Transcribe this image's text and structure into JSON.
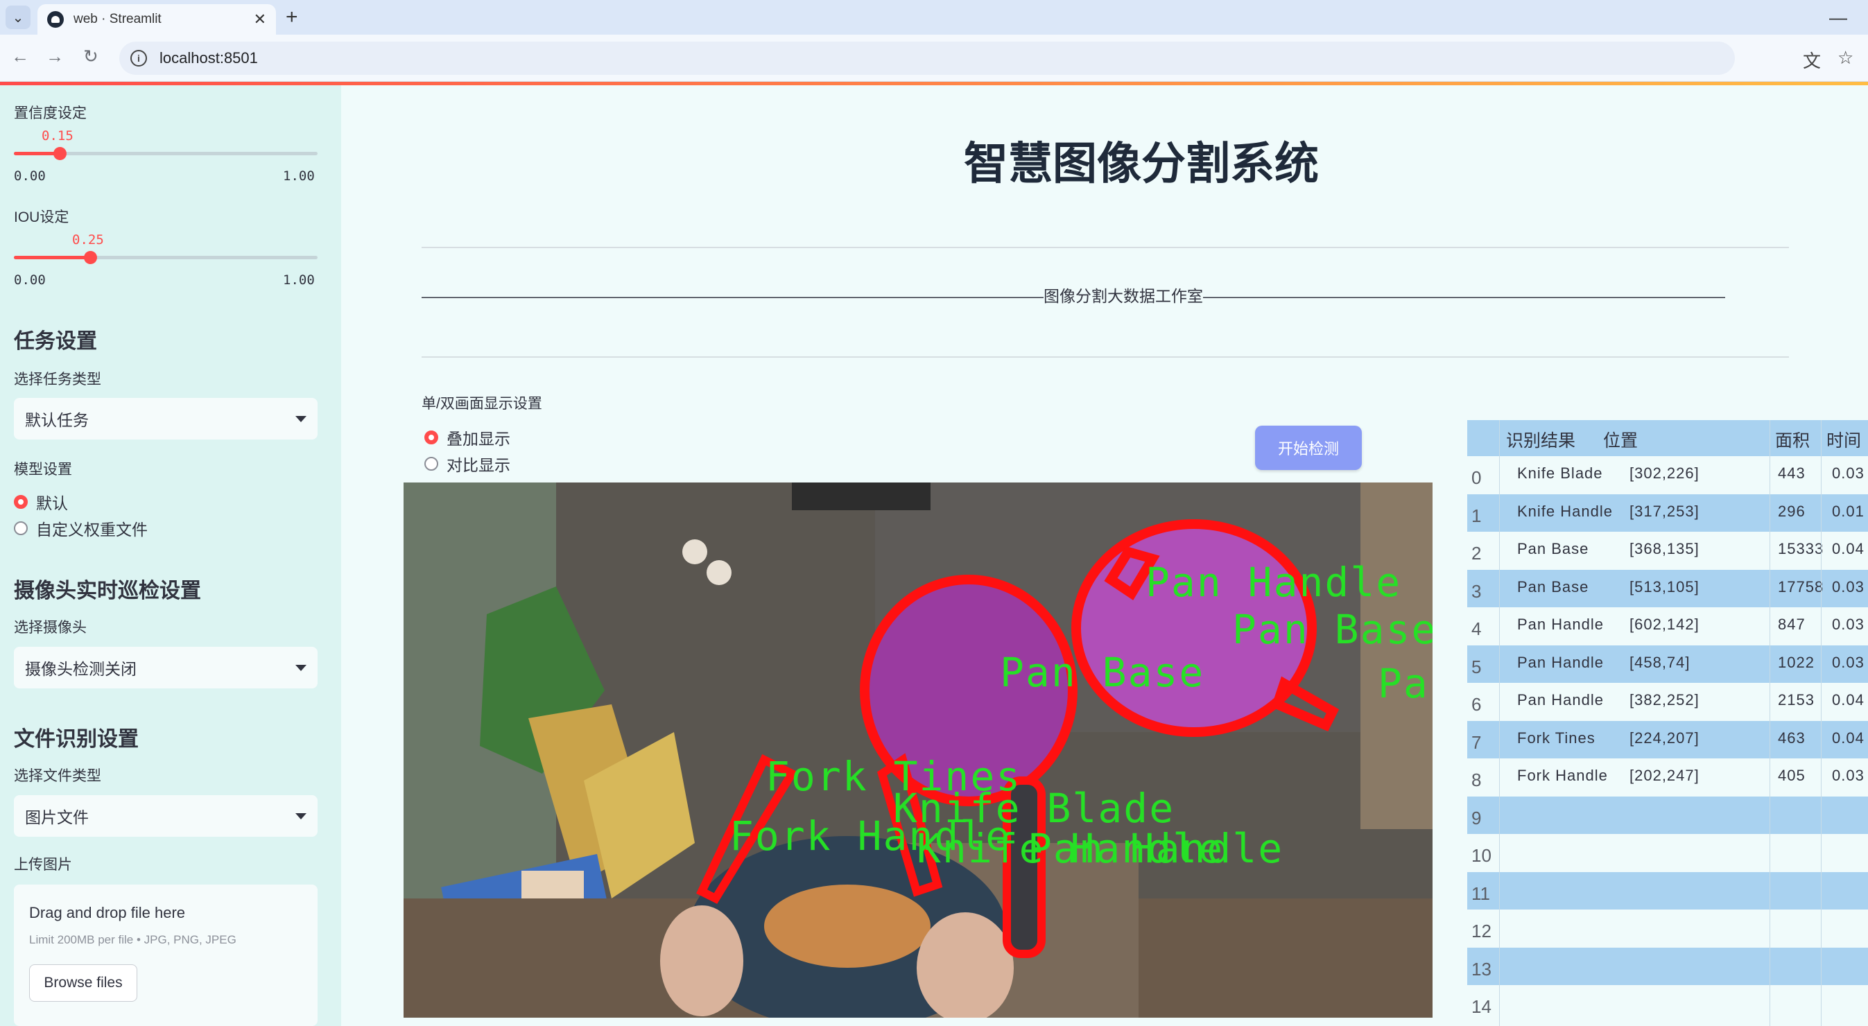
{
  "browser": {
    "tab_title": "web · Streamlit",
    "url": "localhost:8501"
  },
  "sidebar": {
    "confidence": {
      "label": "置信度设定",
      "value": "0.15",
      "min": "0.00",
      "max": "1.00",
      "fraction": 0.15
    },
    "iou": {
      "label": "IOU设定",
      "value": "0.25",
      "min": "0.00",
      "max": "1.00",
      "fraction": 0.25
    },
    "task_heading": "任务设置",
    "task_type_label": "选择任务类型",
    "task_type_value": "默认任务",
    "model_label": "模型设置",
    "model_options": [
      "默认",
      "自定义权重文件"
    ],
    "camera_heading": "摄像头实时巡检设置",
    "camera_label": "选择摄像头",
    "camera_value": "摄像头检测关闭",
    "file_heading": "文件识别设置",
    "file_type_label": "选择文件类型",
    "file_type_value": "图片文件",
    "upload_label": "上传图片",
    "upload_drag": "Drag and drop file here",
    "upload_limit": "Limit 200MB per file • JPG, PNG, JPEG",
    "upload_button": "Browse files"
  },
  "main": {
    "title": "智慧图像分割系统",
    "studio_line": "———————————————————————————————————————图像分割大数据工作室———————————————————————————————————————",
    "view_label": "单/双画面显示设置",
    "view_options": [
      "叠加显示",
      "对比显示"
    ],
    "detect_button": "开始检测"
  },
  "segmentation_labels": [
    "Pan Handle",
    "Pan Base",
    "Pan Base",
    "Pa",
    "Fork Tines",
    "Knife Blade",
    "Fork Handle",
    "Knife Handle",
    "Pan Handle"
  ],
  "results_table": {
    "headers": [
      "识别结果",
      "位置",
      "面积",
      "时间"
    ],
    "rows": [
      {
        "idx": "0",
        "label": "Knife Blade",
        "pos": "[302,226]",
        "area": "443",
        "time": "0.03"
      },
      {
        "idx": "1",
        "label": "Knife Handle",
        "pos": "[317,253]",
        "area": "296",
        "time": "0.01"
      },
      {
        "idx": "2",
        "label": "Pan Base",
        "pos": "[368,135]",
        "area": "15333",
        "time": "0.04"
      },
      {
        "idx": "3",
        "label": "Pan Base",
        "pos": "[513,105]",
        "area": "17758",
        "time": "0.03"
      },
      {
        "idx": "4",
        "label": "Pan Handle",
        "pos": "[602,142]",
        "area": "847",
        "time": "0.03"
      },
      {
        "idx": "5",
        "label": "Pan Handle",
        "pos": "[458,74]",
        "area": "1022",
        "time": "0.03"
      },
      {
        "idx": "6",
        "label": "Pan Handle",
        "pos": "[382,252]",
        "area": "2153",
        "time": "0.04"
      },
      {
        "idx": "7",
        "label": "Fork Tines",
        "pos": "[224,207]",
        "area": "463",
        "time": "0.04"
      },
      {
        "idx": "8",
        "label": "Fork Handle",
        "pos": "[202,247]",
        "area": "405",
        "time": "0.03"
      },
      {
        "idx": "9",
        "label": "",
        "pos": "",
        "area": "",
        "time": ""
      },
      {
        "idx": "10",
        "label": "",
        "pos": "",
        "area": "",
        "time": ""
      },
      {
        "idx": "11",
        "label": "",
        "pos": "",
        "area": "",
        "time": ""
      },
      {
        "idx": "12",
        "label": "",
        "pos": "",
        "area": "",
        "time": ""
      },
      {
        "idx": "13",
        "label": "",
        "pos": "",
        "area": "",
        "time": ""
      },
      {
        "idx": "14",
        "label": "",
        "pos": "",
        "area": "",
        "time": ""
      }
    ]
  }
}
